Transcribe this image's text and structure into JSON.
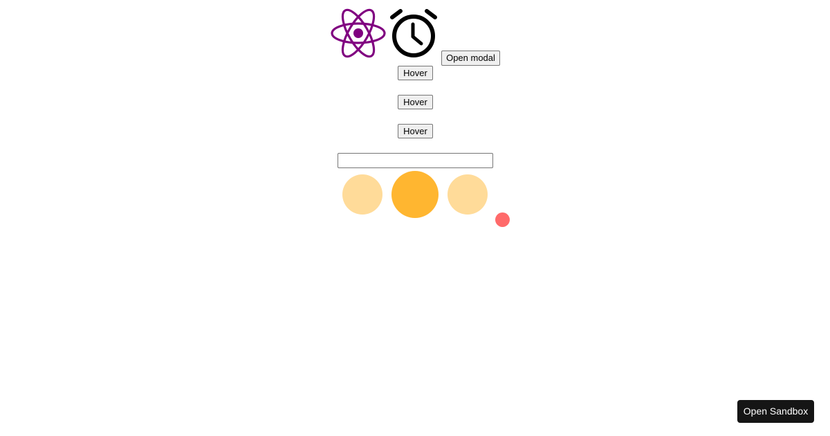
{
  "icons": {
    "react": "react-atom-icon",
    "clock": "alarm-clock-icon"
  },
  "buttons": {
    "open_modal": "Open modal",
    "hover_1": "Hover",
    "hover_2": "Hover",
    "hover_3": "Hover"
  },
  "text_input": {
    "value": "",
    "placeholder": ""
  },
  "sandbox": {
    "label": "Open Sandbox"
  },
  "colors": {
    "react_purple": "#800080",
    "clock_black": "#000000",
    "dot_light": "#ffdb99",
    "dot_active": "#ffb630",
    "cursor_dot": "#ff6a6a",
    "sandbox_bg": "#151515"
  }
}
